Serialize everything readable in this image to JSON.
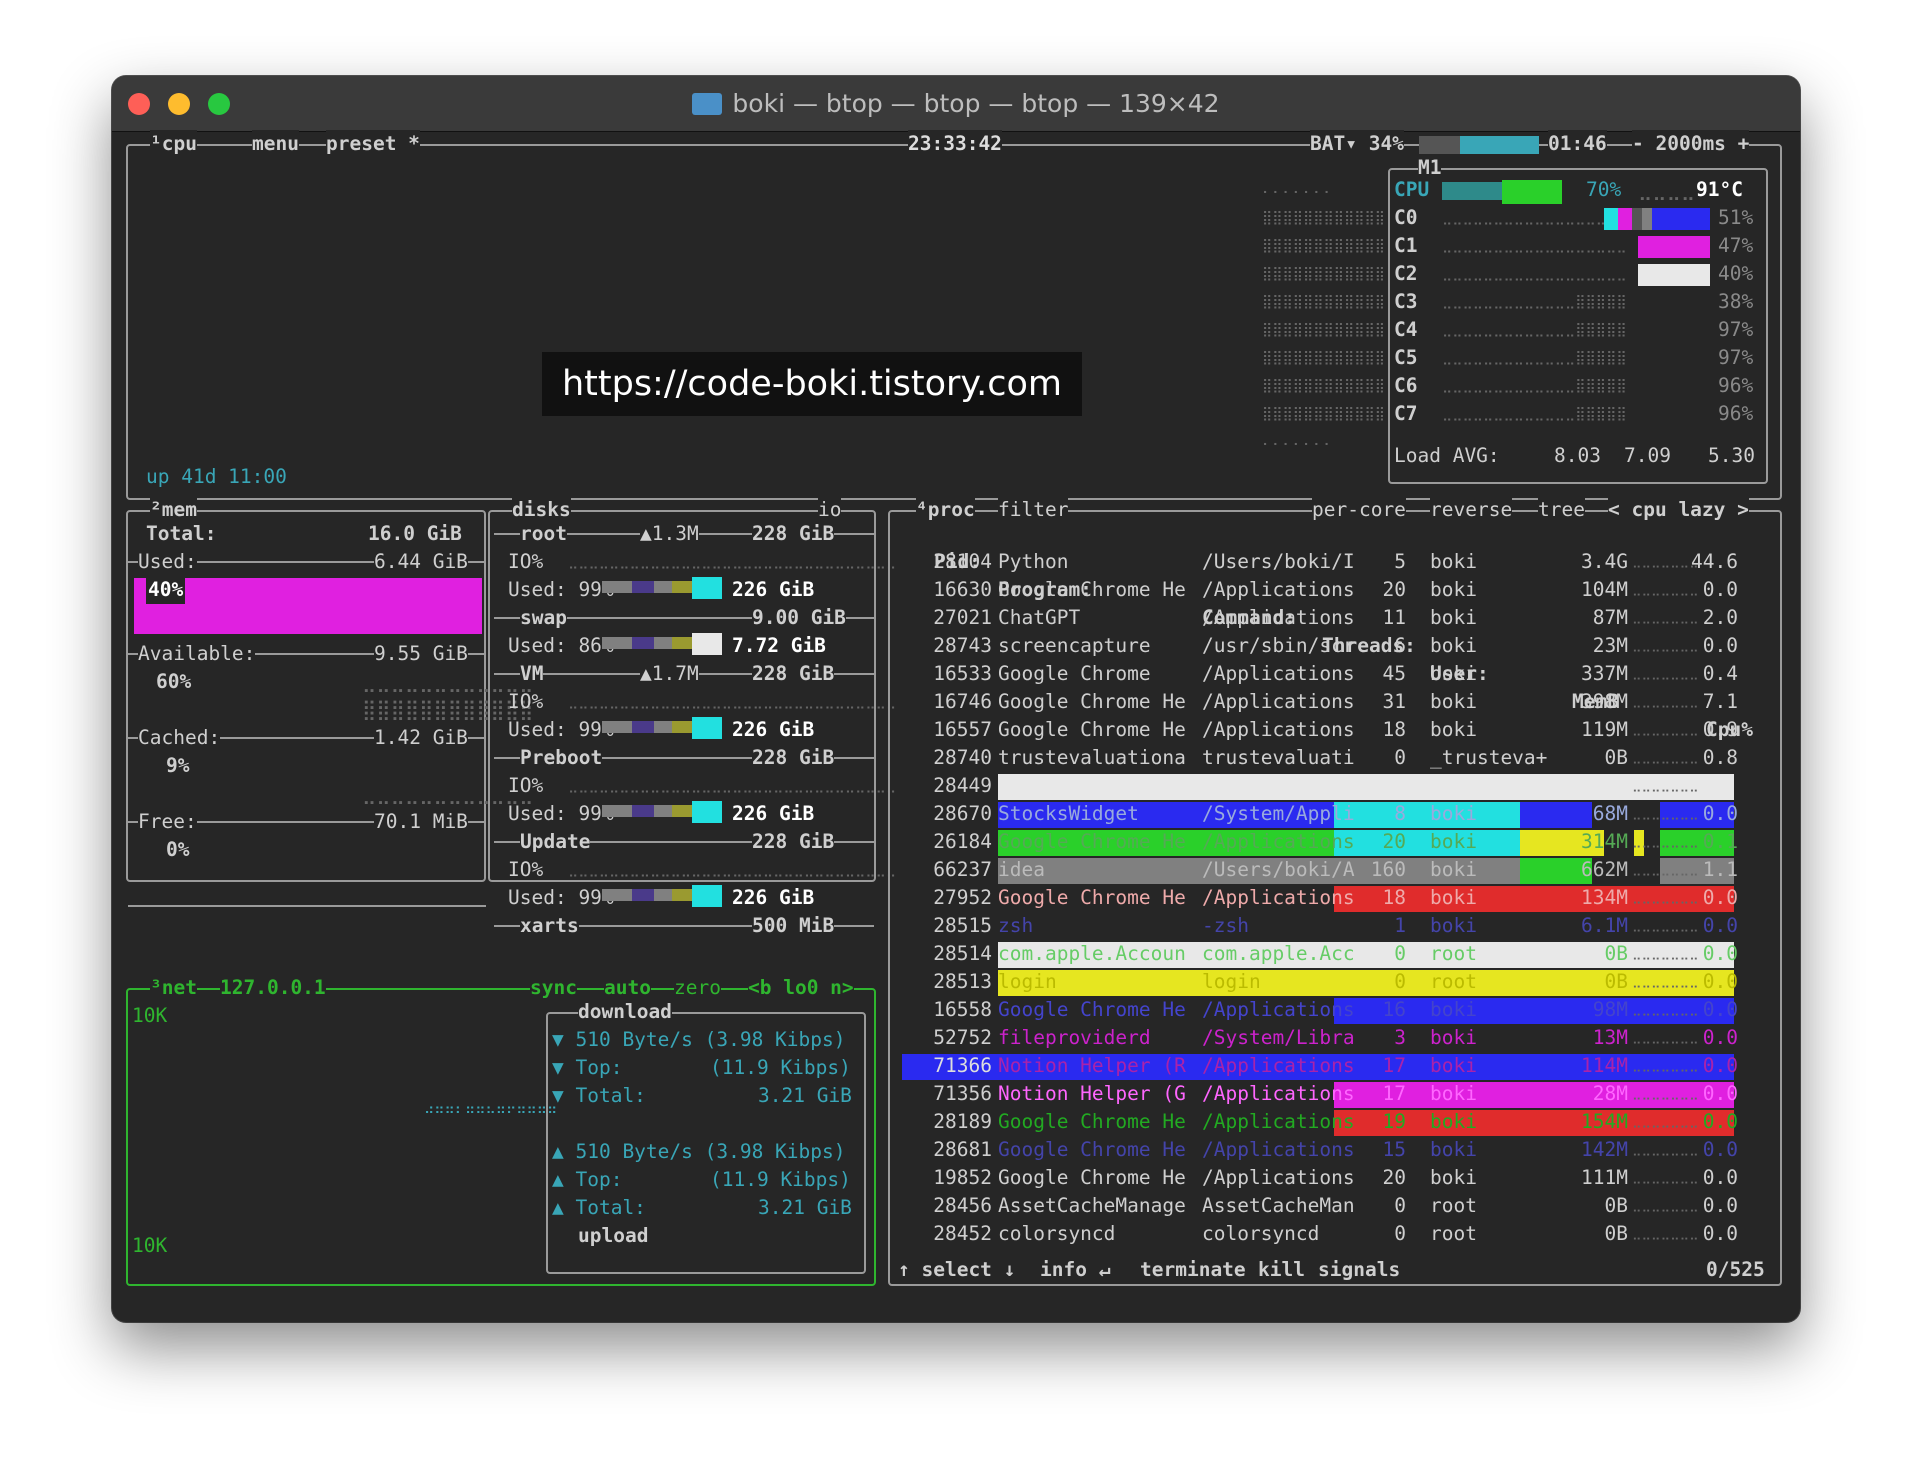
{
  "window": {
    "title": "boki — btop — btop — btop — 139×42"
  },
  "cpu": {
    "tab": "¹cpu",
    "menu": "menu",
    "preset": "preset *",
    "clock": "23:33:42",
    "battery": "BAT▾ 34%",
    "battery_pct": 34,
    "battery_time": "01:46",
    "interval": "- 2000ms +",
    "uptime": "up 41d 11:00",
    "model": "M1",
    "total_label": "CPU",
    "total_pct": "70%",
    "temp": "91°C",
    "cores": [
      {
        "label": "C0",
        "pct": "51%"
      },
      {
        "label": "C1",
        "pct": "47%"
      },
      {
        "label": "C2",
        "pct": "40%"
      },
      {
        "label": "C3",
        "pct": "38%"
      },
      {
        "label": "C4",
        "pct": "97%"
      },
      {
        "label": "C5",
        "pct": "97%"
      },
      {
        "label": "C6",
        "pct": "96%"
      },
      {
        "label": "C7",
        "pct": "96%"
      }
    ],
    "load_label": "Load AVG:",
    "load": [
      "8.03",
      "7.09",
      "5.30"
    ]
  },
  "watermark": "https://code-boki.tistory.com",
  "mem": {
    "tab": "²mem",
    "total_label": "Total:",
    "total": "16.0 GiB",
    "used_label": "Used:",
    "used": "6.44 GiB",
    "used_pct": "40%",
    "avail_label": "Available:",
    "avail": "9.55 GiB",
    "avail_pct": "60%",
    "cached_label": "Cached:",
    "cached": "1.42 GiB",
    "cached_pct": "9%",
    "free_label": "Free:",
    "free": "70.1 MiB",
    "free_pct": "0%"
  },
  "disks": {
    "tab": "disks",
    "io_tab": "io",
    "root": {
      "name": "root",
      "io": "▲1.3M",
      "size": "228 GiB",
      "io_label": "IO%",
      "used_label": "Used: 99%",
      "used": "226 GiB"
    },
    "swap": {
      "name": "swap",
      "size": "9.00 GiB",
      "used_label": "Used: 86%",
      "used": "7.72 GiB"
    },
    "vm": {
      "name": "VM",
      "io": "▲1.7M",
      "size": "228 GiB",
      "io_label": "IO%",
      "used_label": "Used: 99%",
      "used": "226 GiB"
    },
    "preboot": {
      "name": "Preboot",
      "size": "228 GiB",
      "io_label": "IO%",
      "used_label": "Used: 99%",
      "used": "226 GiB"
    },
    "update": {
      "name": "Update",
      "size": "228 GiB",
      "io_label": "IO%",
      "used_label": "Used: 99%",
      "used": "226 GiB"
    },
    "xarts": {
      "name": "xarts",
      "size": "500 MiB"
    }
  },
  "net": {
    "tab": "³net",
    "iface": "127.0.0.1",
    "sync": "sync",
    "auto": "auto",
    "zero": "zero",
    "nav": "<b lo0 n>",
    "scale_top": "10K",
    "scale_bottom": "10K",
    "download_title": "download",
    "upload_title": "upload",
    "down_rate": "▼ 510 Byte/s (3.98 Kibps)",
    "down_top_label": "▼ Top:",
    "down_top": "(11.9 Kibps)",
    "down_total_label": "▼ Total:",
    "down_total": "3.21 GiB",
    "up_rate": "▲ 510 Byte/s (3.98 Kibps)",
    "up_top_label": "▲ Top:",
    "up_top": "(11.9 Kibps)",
    "up_total_label": "▲ Total:",
    "up_total": "3.21 GiB"
  },
  "proc": {
    "tab": "⁴proc",
    "filter": "filter",
    "per_core": "per-core",
    "reverse": "reverse",
    "tree": "tree",
    "sort": "< cpu lazy >",
    "headers": {
      "pid": "Pid:",
      "program": "Program:",
      "command": "Command:",
      "threads": "Threads:",
      "user": "User:",
      "mem": "MemB",
      "cpu": "Cpu%"
    },
    "rows": [
      {
        "pid": "28104",
        "program": "Python",
        "command": "/Users/boki/I",
        "threads": "5",
        "user": "boki",
        "mem": "3.4G",
        "cpu": "44.6"
      },
      {
        "pid": "16630",
        "program": "Google Chrome He",
        "command": "/Applications",
        "threads": "20",
        "user": "boki",
        "mem": "104M",
        "cpu": "0.0"
      },
      {
        "pid": "27021",
        "program": "ChatGPT",
        "command": "/Applications",
        "threads": "11",
        "user": "boki",
        "mem": "87M",
        "cpu": "2.0"
      },
      {
        "pid": "28743",
        "program": "screencapture",
        "command": "/usr/sbin/scr",
        "threads": "6",
        "user": "boki",
        "mem": "23M",
        "cpu": "0.0"
      },
      {
        "pid": "16533",
        "program": "Google Chrome",
        "command": "/Applications",
        "threads": "45",
        "user": "boki",
        "mem": "337M",
        "cpu": "0.4"
      },
      {
        "pid": "16746",
        "program": "Google Chrome He",
        "command": "/Applications",
        "threads": "31",
        "user": "boki",
        "mem": "398M",
        "cpu": "7.1"
      },
      {
        "pid": "16557",
        "program": "Google Chrome He",
        "command": "/Applications",
        "threads": "18",
        "user": "boki",
        "mem": "119M",
        "cpu": "0.9"
      },
      {
        "pid": "28740",
        "program": "trustevaluationa",
        "command": "trustevaluati",
        "threads": "0",
        "user": "_trusteva+",
        "mem": "0B",
        "cpu": "0.8"
      },
      {
        "pid": "28449",
        "program": "",
        "command": "",
        "threads": "",
        "user": "",
        "mem": "",
        "cpu": ""
      },
      {
        "pid": "28670",
        "program": "StocksWidget",
        "command": "/System/Appli",
        "threads": "8",
        "user": "boki",
        "mem": "68M",
        "cpu": "0.0"
      },
      {
        "pid": "26184",
        "program": "Google Chrome He",
        "command": "/Applications",
        "threads": "20",
        "user": "boki",
        "mem": "314M",
        "cpu": "0.1"
      },
      {
        "pid": "66237",
        "program": "idea",
        "command": "/Users/boki/A",
        "threads": "160",
        "user": "boki",
        "mem": "662M",
        "cpu": "1.1"
      },
      {
        "pid": "27952",
        "program": "Google Chrome He",
        "command": "/Applications",
        "threads": "18",
        "user": "boki",
        "mem": "134M",
        "cpu": "0.0"
      },
      {
        "pid": "28515",
        "program": "zsh",
        "command": "-zsh",
        "threads": "1",
        "user": "boki",
        "mem": "6.1M",
        "cpu": "0.0"
      },
      {
        "pid": "28514",
        "program": "com.apple.Accoun",
        "command": "com.apple.Acc",
        "threads": "0",
        "user": "root",
        "mem": "0B",
        "cpu": "0.0"
      },
      {
        "pid": "28513",
        "program": "login",
        "command": "login",
        "threads": "0",
        "user": "root",
        "mem": "0B",
        "cpu": "0.0"
      },
      {
        "pid": "16558",
        "program": "Google Chrome He",
        "command": "/Applications",
        "threads": "16",
        "user": "boki",
        "mem": "98M",
        "cpu": "0.0"
      },
      {
        "pid": "52752",
        "program": "fileproviderd",
        "command": "/System/Libra",
        "threads": "3",
        "user": "boki",
        "mem": "13M",
        "cpu": "0.0"
      },
      {
        "pid": "71366",
        "program": "Notion Helper (R",
        "command": "/Applications",
        "threads": "17",
        "user": "boki",
        "mem": "114M",
        "cpu": "0.0"
      },
      {
        "pid": "71356",
        "program": "Notion Helper (G",
        "command": "/Applications",
        "threads": "17",
        "user": "boki",
        "mem": "28M",
        "cpu": "0.0"
      },
      {
        "pid": "28189",
        "program": "Google Chrome He",
        "command": "/Applications",
        "threads": "19",
        "user": "boki",
        "mem": "154M",
        "cpu": "0.0"
      },
      {
        "pid": "28681",
        "program": "Google Chrome He",
        "command": "/Applications",
        "threads": "15",
        "user": "boki",
        "mem": "142M",
        "cpu": "0.0"
      },
      {
        "pid": "19852",
        "program": "Google Chrome He",
        "command": "/Applications",
        "threads": "20",
        "user": "boki",
        "mem": "111M",
        "cpu": "0.0"
      },
      {
        "pid": "28456",
        "program": "AssetCacheManage",
        "command": "AssetCacheMan",
        "threads": "0",
        "user": "root",
        "mem": "0B",
        "cpu": "0.0"
      },
      {
        "pid": "28452",
        "program": "colorsyncd",
        "command": "colorsyncd",
        "threads": "0",
        "user": "root",
        "mem": "0B",
        "cpu": "0.0"
      }
    ],
    "footer": {
      "select": "↑ select ↓",
      "info": "info ↵",
      "terminate": "terminate",
      "kill": "kill",
      "signals": "signals",
      "count": "0/525"
    }
  },
  "colors": {
    "border": "#9a9a9a",
    "cyan": "#39a6b7",
    "green": "#2fb52f",
    "magenta": "#e020e0",
    "blue": "#2a2af0",
    "yellow": "#e6e620",
    "red": "#e02c2c",
    "lime": "#2ad02a",
    "aqua": "#22e0e0",
    "white": "#e8e8e8",
    "gray": "#808080"
  }
}
